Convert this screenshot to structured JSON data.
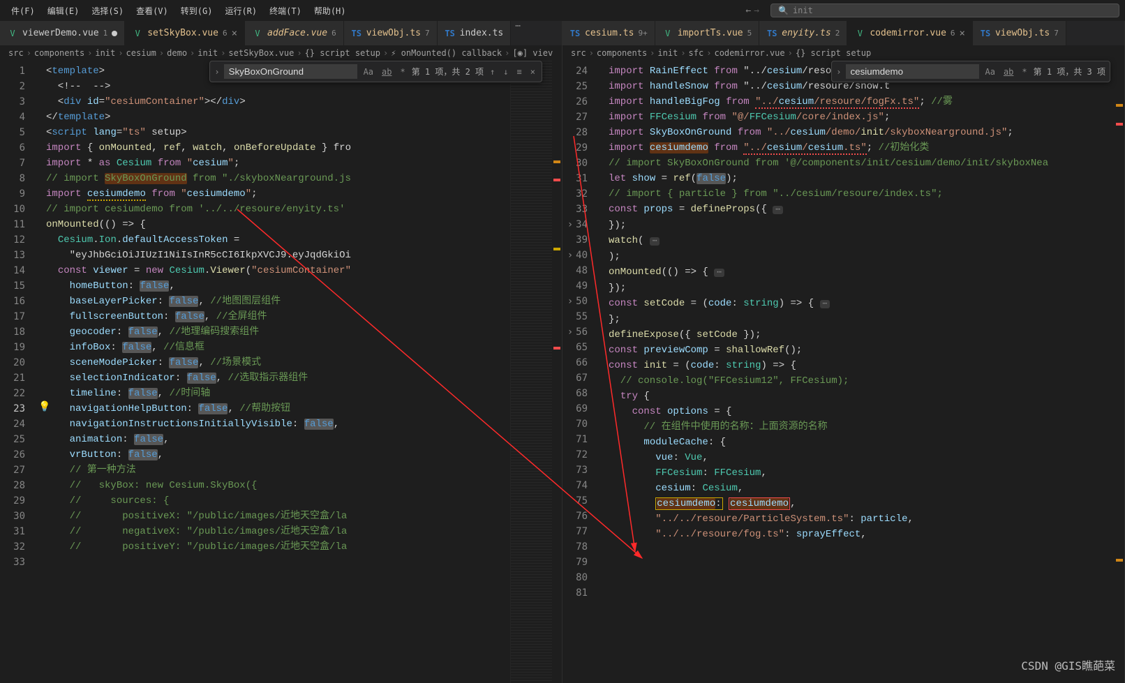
{
  "menubar": [
    "件(F)",
    "编辑(E)",
    "选择(S)",
    "查看(V)",
    "转到(G)",
    "运行(R)",
    "终端(T)",
    "帮助(H)"
  ],
  "search": {
    "icon": "search-icon",
    "text": "init"
  },
  "leftPane": {
    "tabs": [
      {
        "icon": "vue",
        "label": "viewerDemo.vue",
        "badge": "1",
        "modified": false,
        "close": true
      },
      {
        "icon": "vue",
        "label": "setSkyBox.vue",
        "badge": "6",
        "modified": true,
        "active": true,
        "close": true
      },
      {
        "icon": "vue",
        "label": "addFace.vue",
        "badge": "6",
        "modified": true,
        "italic": true
      },
      {
        "icon": "ts",
        "label": "viewObj.ts",
        "badge": "7",
        "modified": true
      },
      {
        "icon": "ts",
        "label": "index.ts",
        "badge": "",
        "modified": false
      }
    ],
    "breadcrumb": [
      "src",
      "components",
      "init",
      "cesium",
      "demo",
      "init",
      "setSkyBox.vue",
      "{} script setup",
      "onMounted() callback",
      "viev"
    ],
    "find": {
      "value": "SkyBoxOnGround",
      "toggles": [
        "Aa",
        "ab",
        "*"
      ],
      "count": "第 1 项，共 2 项"
    },
    "lines": {
      "start": 1,
      "activeLine": 23,
      "lightbulbLine": 23,
      "rows": [
        "<template>",
        "  <!--  -->",
        "  <div id=\"cesiumContainer\"></div>",
        "</template>",
        "<script lang=\"ts\" setup>",
        "import { onMounted, ref, watch, onBeforeUpdate } fro",
        "import * as Cesium from \"cesium\";",
        "// import SkyBoxOnGround from \"./skyboxNearground.js",
        "import cesiumdemo from \"cesiumdemo\";",
        "// import cesiumdemo from '../../resoure/enyity.ts'",
        "onMounted(() => {",
        "  Cesium.Ion.defaultAccessToken =",
        "    \"eyJhbGciOiJIUzI1NiIsInR5cCI6IkpXVCJ9.eyJqdGkiOi",
        "  const viewer = new Cesium.Viewer(\"cesiumContainer\"",
        "    homeButton: false,",
        "    baseLayerPicker: false, //地图图层组件",
        "    fullscreenButton: false, //全屏组件",
        "    geocoder: false, //地理编码搜索组件",
        "    infoBox: false, //信息框",
        "    sceneModePicker: false, //场景模式",
        "    selectionIndicator: false, //选取指示器组件",
        "    timeline: false, //时间轴",
        "    navigationHelpButton: false, //帮助按钮",
        "    navigationInstructionsInitiallyVisible: false,",
        "    animation: false,",
        "    vrButton: false,",
        "",
        "    // 第一种方法",
        "    //   skyBox: new Cesium.SkyBox({",
        "    //     sources: {",
        "    //       positiveX: \"/public/images/近地天空盒/la",
        "    //       negativeX: \"/public/images/近地天空盒/la",
        "    //       positiveY: \"/public/images/近地天空盒/la"
      ]
    }
  },
  "rightPane": {
    "tabs": [
      {
        "icon": "ts",
        "label": "cesium.ts",
        "badge": "9+",
        "modified": true
      },
      {
        "icon": "vue",
        "label": "importTs.vue",
        "badge": "5",
        "modified": true
      },
      {
        "icon": "ts",
        "label": "enyity.ts",
        "badge": "2",
        "modified": true,
        "italic": true
      },
      {
        "icon": "vue",
        "label": "codemirror.vue",
        "badge": "6",
        "modified": true,
        "active": true,
        "close": true
      },
      {
        "icon": "ts",
        "label": "viewObj.ts",
        "badge": "7",
        "modified": true
      }
    ],
    "breadcrumb": [
      "src",
      "components",
      "init",
      "sfc",
      "codemirror.vue",
      "{} script setup"
    ],
    "find": {
      "value": "cesiumdemo",
      "toggles": [
        "Aa",
        "ab",
        "*"
      ],
      "count": "第 1 项，共 3 项"
    },
    "lines": {
      "numbers": [
        24,
        25,
        26,
        27,
        28,
        29,
        30,
        31,
        32,
        33,
        34,
        39,
        40,
        48,
        49,
        50,
        55,
        56,
        65,
        66,
        67,
        68,
        69,
        70,
        71,
        72,
        73,
        74,
        75,
        76,
        77,
        78,
        79,
        80,
        81
      ],
      "folds": [
        34,
        40,
        50,
        56
      ],
      "rows": [
        "import RainEffect from \"../cesium/resoure/rain.t",
        "import handleSnow from \"../cesium/resoure/snow.t",
        "import handleBigFog from \"../cesium/resoure/fogFx.ts\"; //雾",
        "import FFCesium from \"@/FFCesium/core/index.js\";",
        "import SkyBoxOnGround from \"../cesium/demo/init/skyboxNearground.js\";",
        "import cesiumdemo from \"../cesium/cesium.ts\"; //初始化类",
        "// import SkyBoxOnGround from '@/components/init/cesium/demo/init/skyboxNea",
        "",
        "let show = ref(false);",
        "// import { particle } from \"../cesium/resoure/index.ts\";",
        "const props = defineProps({ …",
        "});",
        "watch( …",
        ");",
        "",
        "onMounted(() => { …",
        "});",
        "const setCode = (code: string) => { …",
        "};",
        "",
        "defineExpose({ setCode });",
        "",
        "const previewComp = shallowRef();",
        "const init = (code: string) => {",
        "  // console.log(\"FFCesium12\", FFCesium);",
        "  try {",
        "    const options = {",
        "      // 在组件中使用的名称：上面资源的名称",
        "      moduleCache: {",
        "        vue: Vue,",
        "        FFCesium: FFCesium,",
        "        cesium: Cesium,",
        "        cesiumdemo: cesiumdemo,",
        "        \"../../resoure/ParticleSystem.ts\": particle,",
        "        \"../../resoure/fog.ts\": sprayEffect,"
      ]
    }
  },
  "watermark": "CSDN @GIS瞧葩菜"
}
